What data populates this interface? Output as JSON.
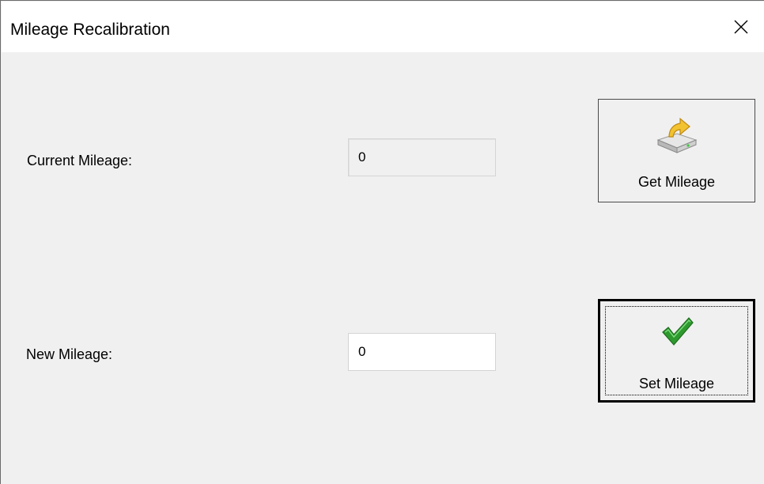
{
  "window": {
    "title": "Mileage Recalibration"
  },
  "form": {
    "current_label": "Current Mileage:",
    "current_value": "0",
    "new_label": "New Mileage:",
    "new_value": "0"
  },
  "buttons": {
    "get_label": "Get Mileage",
    "get_icon": "drive-arrow-up-icon",
    "set_label": "Set Mileage",
    "set_icon": "green-checkmark-icon"
  },
  "colors": {
    "window_bg": "#f0f0f0",
    "titlebar_bg": "#ffffff",
    "checkmark_green": "#2e9a2e",
    "arrow_yellow": "#f2c230"
  }
}
